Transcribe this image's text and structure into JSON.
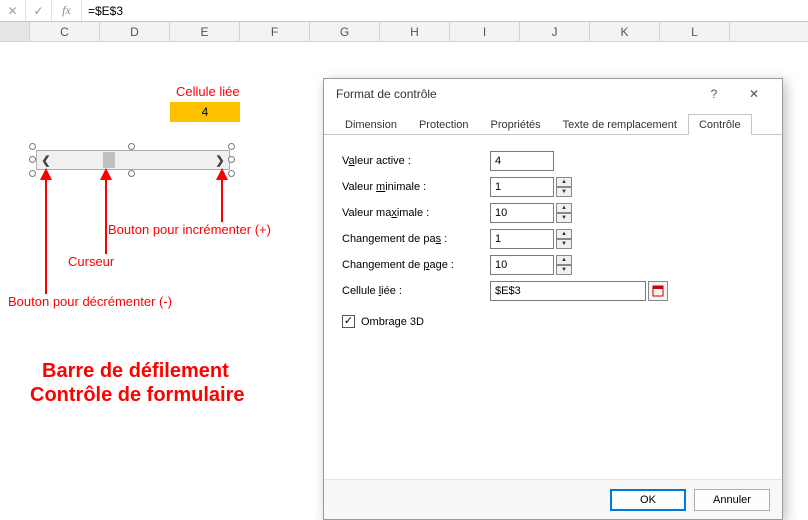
{
  "formula_bar": {
    "cancel_glyph": "✕",
    "confirm_glyph": "✓",
    "fx_label": "fx",
    "value": "=$E$3"
  },
  "columns": [
    "C",
    "D",
    "E",
    "F",
    "G",
    "H",
    "I",
    "J",
    "K",
    "L"
  ],
  "linked_cell_value": "4",
  "annotations": {
    "cellule_liee": "Cellule liée",
    "bouton_inc": "Bouton pour incrémenter (+)",
    "curseur": "Curseur",
    "bouton_dec": "Bouton pour décrémenter (-)",
    "title1": "Barre de défilement",
    "title2": "Contrôle de formulaire"
  },
  "scrollbar": {
    "left_glyph": "❮",
    "right_glyph": "❯"
  },
  "dialog": {
    "title": "Format de contrôle",
    "help_glyph": "?",
    "close_glyph": "✕",
    "tabs": {
      "dimension": "Dimension",
      "protection": "Protection",
      "proprietes": "Propriétés",
      "texte": "Texte de remplacement",
      "controle": "Contrôle"
    },
    "fields": {
      "valeur_active": {
        "label_pre": "V",
        "label_u": "a",
        "label_post": "leur active :",
        "value": "4"
      },
      "valeur_min": {
        "label_pre": "Valeur ",
        "label_u": "m",
        "label_post": "inimale :",
        "value": "1"
      },
      "valeur_max": {
        "label_pre": "Valeur ma",
        "label_u": "x",
        "label_post": "imale :",
        "value": "10"
      },
      "chg_pas": {
        "label_pre": "Changement de pa",
        "label_u": "s",
        "label_post": " :",
        "value": "1"
      },
      "chg_page": {
        "label_pre": "Changement de ",
        "label_u": "p",
        "label_post": "age :",
        "value": "10"
      },
      "cellule_liee": {
        "label_pre": "Cellule ",
        "label_u": "l",
        "label_post": "iée :",
        "value": "$E$3"
      }
    },
    "checkbox": {
      "checked_glyph": "✓",
      "label_pre": "Ombrage ",
      "label_u": "3",
      "label_post": "D"
    },
    "buttons": {
      "ok": "OK",
      "cancel": "Annuler"
    }
  }
}
